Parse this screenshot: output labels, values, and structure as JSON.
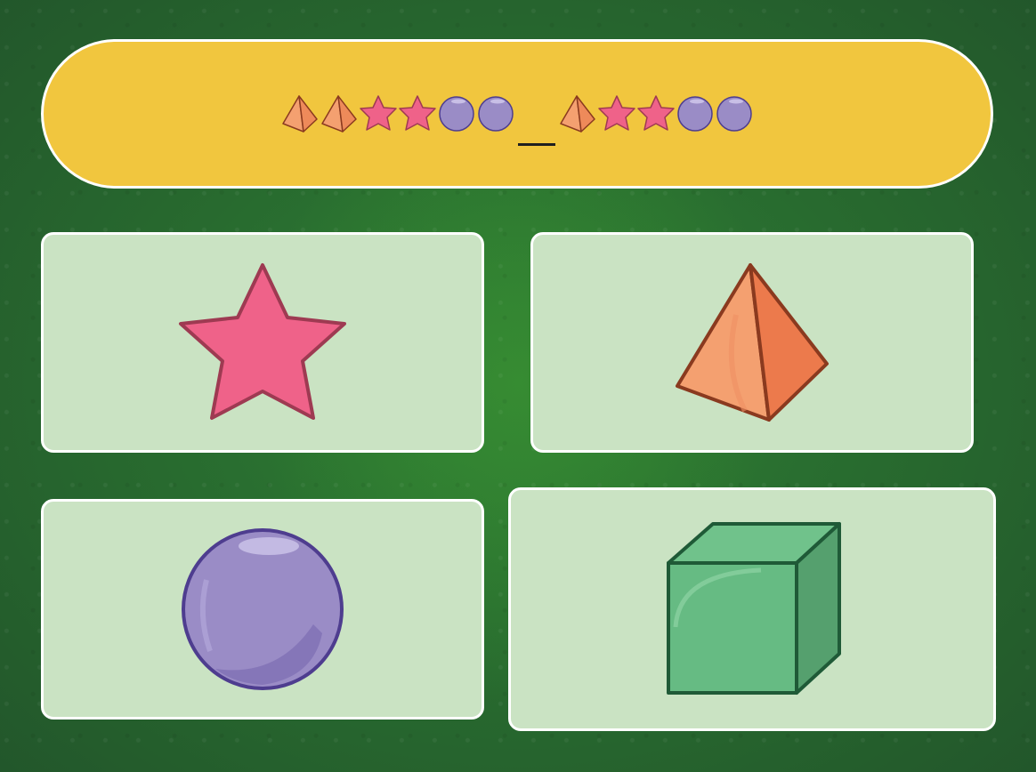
{
  "sequence": {
    "before_blank": [
      "pyramid",
      "pyramid",
      "star",
      "star",
      "sphere",
      "sphere"
    ],
    "after_blank": [
      "pyramid",
      "star",
      "star",
      "sphere",
      "sphere"
    ]
  },
  "options": [
    {
      "shape": "star"
    },
    {
      "shape": "pyramid"
    },
    {
      "shape": "sphere"
    },
    {
      "shape": "cube"
    }
  ],
  "colors": {
    "star": "#ef6289",
    "pyramid": "#ee8a5a",
    "sphere": "#9a8cc6",
    "cube": "#66bb83",
    "banner": "#f1c63e",
    "card": "#cae3c3"
  }
}
